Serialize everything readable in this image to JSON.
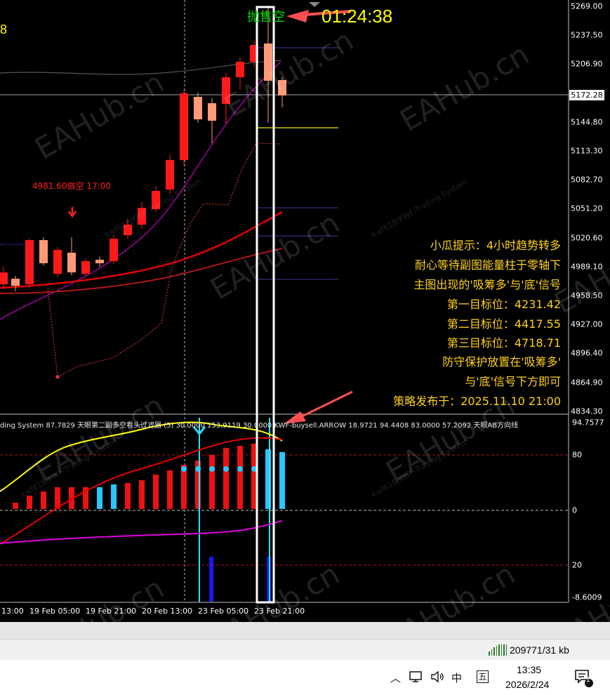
{
  "chart": {
    "countdown_prefix": "抛售空",
    "countdown": "01:24:38",
    "left_edge_value": "8",
    "current_price": "5172.28",
    "signal_label": "4981.60做空 17:00",
    "y_axis_labels": [
      "5269.00",
      "5237.50",
      "5206.90",
      "5144.80",
      "5113.30",
      "5082.70",
      "5051.20",
      "5020.60",
      "4989.10",
      "4958.50",
      "4927.00",
      "4896.40",
      "4864.90",
      "4834.30"
    ],
    "x_axis_labels": [
      "13:00",
      "19 Feb 05:00",
      "19 Feb 21:00",
      "20 Feb 13:00",
      "23 Feb 05:00",
      "23 Feb 21:00"
    ],
    "indicator_header": "ding System 87.7829  天眼第二副多空看头过滤器 (5)  30.0000  153.9119  30.0000  KWF-buysell.ARROW 18.9721 94.4408 83.0000 57.2092  天眼AB方向线",
    "sub_y_labels": [
      "94.7577",
      "80",
      "0",
      "20",
      "-8.6009"
    ],
    "tips": [
      "小瓜提示：4小时趋势转多",
      "耐心等待副图能量柱于零轴下",
      "主图出现的'吸筹多'与'底'信号",
      "第一目标位：4231.42",
      "第二目标位：4417.55",
      "第三目标位：4718.71",
      "防守保护放置在'吸筹多'",
      "与'底'信号下方即可",
      "策略发布于：2025.11.10 21:00"
    ],
    "watermark": "EAHub.cn",
    "watermark_small": "kwf618/KWF-Trading System",
    "colors": {
      "bull": "#ff1a1a",
      "bear": "#ff9a78",
      "accent": "#ffff00",
      "highlight": "#ffffff"
    }
  },
  "status": {
    "traffic": "209771/31 kb"
  },
  "taskbar": {
    "ime_lang": "中",
    "ime_mode": "五",
    "time": "13:35",
    "date": "2026/2/24",
    "notification_count": "1"
  }
}
